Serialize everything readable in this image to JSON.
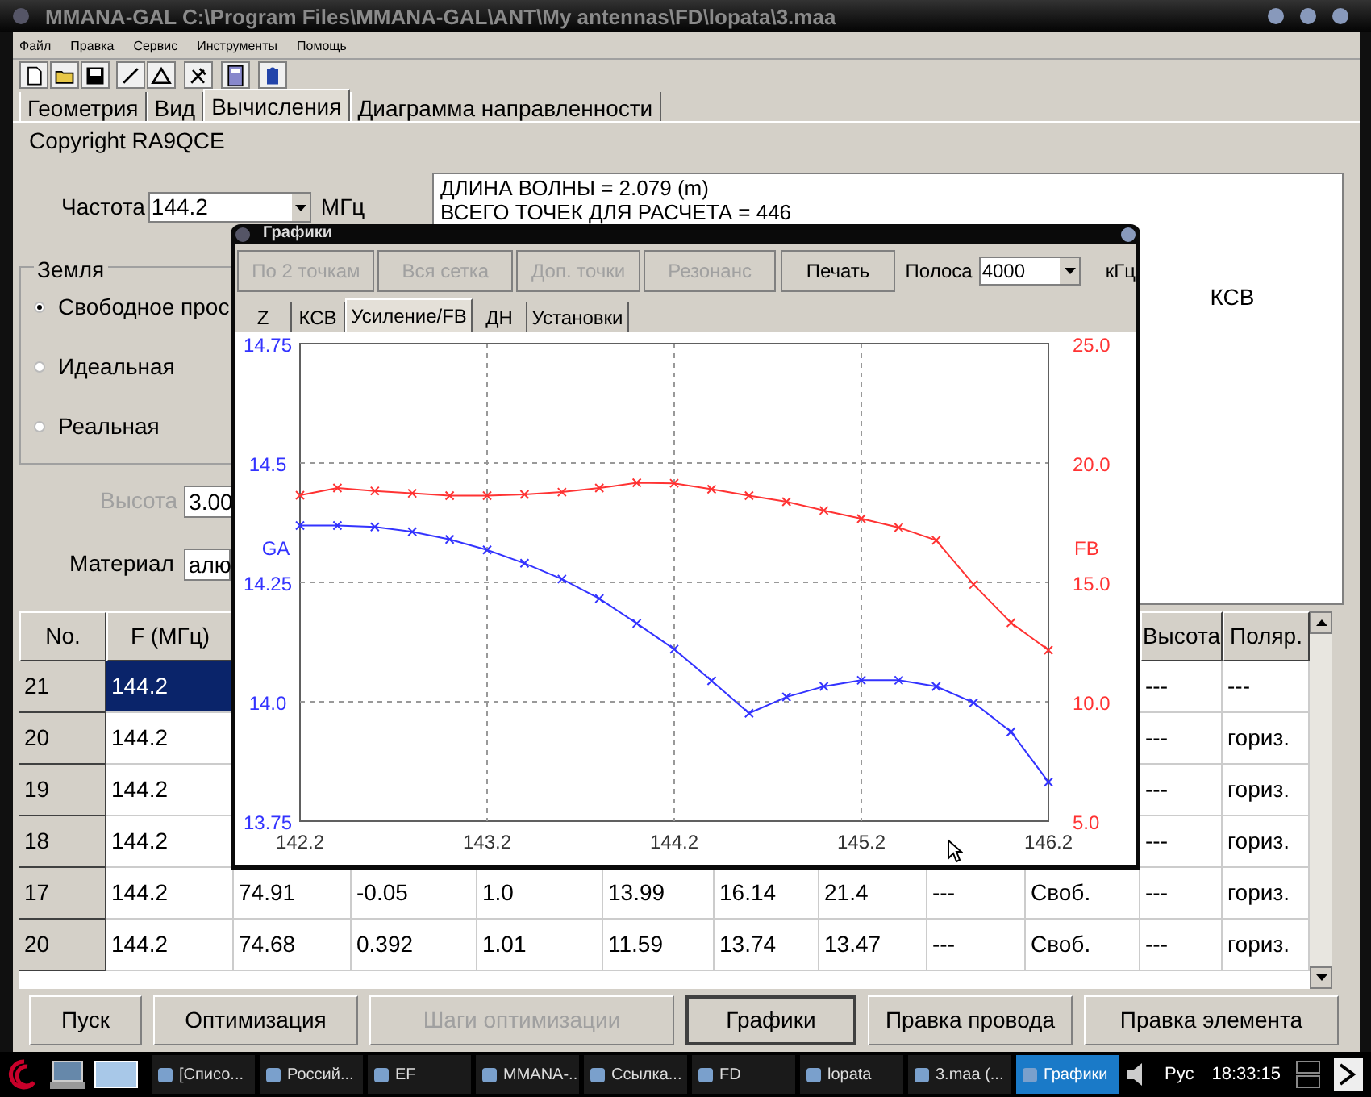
{
  "window": {
    "title": "MMANA-GAL C:\\Program Files\\MMANA-GAL\\ANT\\My antennas\\FD\\lopata\\3.maa"
  },
  "menu": [
    "Файл",
    "Правка",
    "Сервис",
    "Инструменты",
    "Помощь"
  ],
  "tabs": [
    {
      "label": "Геометрия",
      "selected": false
    },
    {
      "label": "Вид",
      "selected": false
    },
    {
      "label": "Вычисления",
      "selected": true
    },
    {
      "label": "Диаграмма направленности",
      "selected": false
    }
  ],
  "copyright": "Copyright RA9QCE",
  "frequency": {
    "label": "Частота",
    "value": "144.2",
    "unit": "МГц"
  },
  "ground": {
    "title": "Земля",
    "options": [
      {
        "label": "Свободное прос",
        "selected": true
      },
      {
        "label": "Идеальная",
        "selected": false
      },
      {
        "label": "Реальная",
        "selected": false
      }
    ]
  },
  "height": {
    "label": "Высота",
    "value": "3.00",
    "disabled": true
  },
  "material": {
    "label": "Материал",
    "value": "алю"
  },
  "info": {
    "lines": [
      "ДЛИНА ВОЛНЫ = 2.079 (m)",
      "ВСЕГО ТОЧЕК ДЛЯ РАСЧЕТА = 446"
    ],
    "swr_label": "КСВ"
  },
  "table": {
    "columns": [
      "No.",
      "F (МГц)",
      null,
      null,
      null,
      null,
      null,
      null,
      null,
      null,
      "Высота",
      "Поляр."
    ],
    "rows": [
      {
        "selected": true,
        "cells": [
          "21",
          "144.2",
          null,
          null,
          null,
          null,
          null,
          null,
          null,
          null,
          "---",
          "---"
        ]
      },
      {
        "selected": false,
        "cells": [
          "20",
          "144.2",
          null,
          null,
          null,
          null,
          null,
          null,
          null,
          null,
          "---",
          "гориз."
        ]
      },
      {
        "selected": false,
        "cells": [
          "19",
          "144.2",
          null,
          null,
          null,
          null,
          null,
          null,
          null,
          null,
          "---",
          "гориз."
        ]
      },
      {
        "selected": false,
        "cells": [
          "18",
          "144.2",
          null,
          null,
          null,
          null,
          null,
          null,
          null,
          null,
          "---",
          "гориз."
        ]
      },
      {
        "selected": false,
        "cells": [
          "17",
          "144.2",
          "74.91",
          "-0.05",
          "1.0",
          "13.99",
          "16.14",
          "21.4",
          "---",
          "Своб.",
          "---",
          "гориз."
        ]
      },
      {
        "selected": false,
        "cells": [
          "20",
          "144.2",
          "74.68",
          "0.392",
          "1.01",
          "11.59",
          "13.74",
          "13.47",
          "---",
          "Своб.",
          "---",
          "гориз."
        ]
      }
    ]
  },
  "buttons": [
    {
      "label": "Пуск",
      "disabled": false,
      "pressed": false
    },
    {
      "label": "Оптимизация",
      "disabled": false,
      "pressed": false
    },
    {
      "label": "Шаги оптимизации",
      "disabled": true,
      "pressed": false
    },
    {
      "label": "Графики",
      "disabled": false,
      "pressed": true
    },
    {
      "label": "Правка провода",
      "disabled": false,
      "pressed": false
    },
    {
      "label": "Правка элемента",
      "disabled": false,
      "pressed": false
    }
  ],
  "graphs_window": {
    "title": "Графики",
    "buttons": [
      {
        "label": "По 2 точкам",
        "disabled": true
      },
      {
        "label": "Вся сетка",
        "disabled": true
      },
      {
        "label": "Доп. точки",
        "disabled": true
      },
      {
        "label": "Резонанс",
        "disabled": true
      },
      {
        "label": "Печать",
        "disabled": false
      }
    ],
    "band": {
      "label": "Полоса",
      "value": "4000",
      "unit": "кГц"
    },
    "tabs": [
      {
        "label": "Z",
        "selected": false
      },
      {
        "label": "КСВ",
        "selected": false
      },
      {
        "label": "Усиление/FB",
        "selected": true
      },
      {
        "label": "ДН",
        "selected": false
      },
      {
        "label": "Установки",
        "selected": false
      }
    ],
    "chart_data": {
      "type": "line",
      "grid": true,
      "x": [
        142.2,
        142.4,
        142.6,
        142.8,
        143.0,
        143.2,
        143.4,
        143.6,
        143.8,
        144.0,
        144.2,
        144.4,
        144.6,
        144.8,
        145.0,
        145.2,
        145.4,
        145.6,
        145.8,
        146.0,
        146.2
      ],
      "xlim": [
        142.2,
        146.2
      ],
      "xticks": [
        {
          "value": 142.2,
          "label": "142.2"
        },
        {
          "value": 143.2,
          "label": "143.2"
        },
        {
          "value": 144.2,
          "label": "144.2"
        },
        {
          "value": 145.2,
          "label": "145.2"
        },
        {
          "value": 146.2,
          "label": "146.2"
        }
      ],
      "ylim": [
        13.75,
        14.75
      ],
      "yticks": [
        {
          "value": 13.75,
          "label": "13.75"
        },
        {
          "value": 14.0,
          "label": "14.0"
        },
        {
          "value": 14.25,
          "label": "14.25"
        },
        {
          "value": 14.5,
          "label": "14.5"
        },
        {
          "value": 14.75,
          "label": "14.75"
        }
      ],
      "y2lim": [
        5,
        25
      ],
      "y2ticks": [
        {
          "value": 5,
          "label": "5.0"
        },
        {
          "value": 10,
          "label": "10.0"
        },
        {
          "value": 15,
          "label": "15.0"
        },
        {
          "value": 20,
          "label": "20.0"
        },
        {
          "value": 25,
          "label": "25.0"
        }
      ],
      "series": [
        {
          "name": "GA",
          "color": "#3333ff",
          "marker": "x",
          "values": [
            14.369,
            14.369,
            14.366,
            14.356,
            14.34,
            14.318,
            14.29,
            14.257,
            14.216,
            14.164,
            14.11,
            14.044,
            13.976,
            14.01,
            14.032,
            14.045,
            14.045,
            14.032,
            13.998,
            13.937,
            13.832
          ]
        },
        {
          "name": "FB",
          "color": "#ff3333",
          "axis": "y2",
          "marker": "x",
          "values": [
            18.65,
            18.95,
            18.83,
            18.73,
            18.63,
            18.63,
            18.68,
            18.78,
            18.95,
            19.17,
            19.15,
            18.9,
            18.63,
            18.38,
            18.01,
            17.67,
            17.3,
            16.76,
            14.91,
            13.31,
            12.16
          ]
        }
      ]
    }
  },
  "taskbar": {
    "tasks": [
      {
        "label": "[Списо...",
        "selected": false
      },
      {
        "label": "Россий...",
        "selected": false
      },
      {
        "label": "EF",
        "selected": false
      },
      {
        "label": "MMANA-...",
        "selected": false
      },
      {
        "label": "Ссылка...",
        "selected": false
      },
      {
        "label": "FD",
        "selected": false
      },
      {
        "label": "lopata",
        "selected": false
      },
      {
        "label": "3.maa (...",
        "selected": false
      },
      {
        "label": "Графики",
        "selected": true
      }
    ],
    "language": "Рус",
    "clock": "18:33:15"
  }
}
